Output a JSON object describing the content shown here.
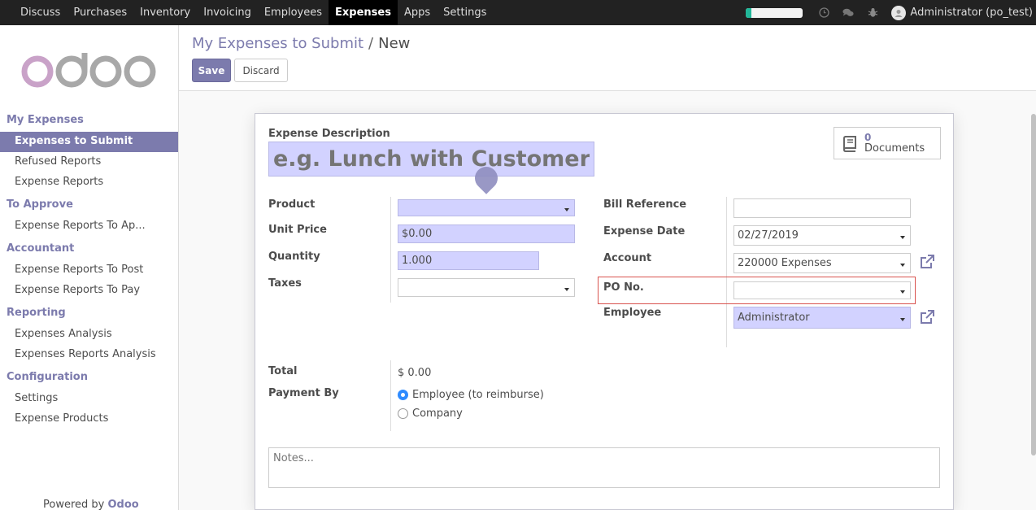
{
  "topbar": {
    "menu": [
      "Discuss",
      "Purchases",
      "Inventory",
      "Invoicing",
      "Employees",
      "Expenses",
      "Apps",
      "Settings"
    ],
    "active": "Expenses",
    "user": "Administrator (po_test)",
    "icons": [
      "clock-icon",
      "chat-icon",
      "bug-icon"
    ],
    "progress": 0.1
  },
  "sidebar": {
    "sections": [
      {
        "title": "My Expenses",
        "items": [
          "Expenses to Submit",
          "Refused Reports",
          "Expense Reports"
        ]
      },
      {
        "title": "To Approve",
        "items": [
          "Expense Reports To Ap..."
        ]
      },
      {
        "title": "Accountant",
        "items": [
          "Expense Reports To Post",
          "Expense Reports To Pay"
        ]
      },
      {
        "title": "Reporting",
        "items": [
          "Expenses Analysis",
          "Expenses Reports Analysis"
        ]
      },
      {
        "title": "Configuration",
        "items": [
          "Settings",
          "Expense Products"
        ]
      }
    ],
    "active_item": "Expenses to Submit",
    "powered_prefix": "Powered by",
    "powered_brand": "Odoo"
  },
  "control": {
    "breadcrumb_parent": "My Expenses to Submit",
    "breadcrumb_separator": "/",
    "breadcrumb_current": "New",
    "save_label": "Save",
    "discard_label": "Discard"
  },
  "form": {
    "description_label": "Expense Description",
    "description_placeholder": "e.g. Lunch with Customer",
    "documents_count": "0",
    "documents_label": "Documents",
    "product_label": "Product",
    "product_value": "",
    "unit_price_label": "Unit Price",
    "unit_price_value": "$0.00",
    "quantity_label": "Quantity",
    "quantity_value": "1.000",
    "taxes_label": "Taxes",
    "taxes_value": "",
    "bill_reference_label": "Bill Reference",
    "bill_reference_value": "",
    "expense_date_label": "Expense Date",
    "expense_date_value": "02/27/2019",
    "account_label": "Account",
    "account_value": "220000 Expenses",
    "po_label": "PO No.",
    "po_value": "",
    "employee_label": "Employee",
    "employee_value": "Administrator",
    "total_label": "Total",
    "total_value": "$ 0.00",
    "payment_label": "Payment By",
    "payment_options": [
      "Employee (to reimburse)",
      "Company"
    ],
    "payment_selected": "Employee (to reimburse)",
    "notes_placeholder": "Notes..."
  },
  "colors": {
    "brand": "#7c7bad",
    "required_field": "#d2d2ff",
    "highlight": "#d9534f",
    "radio_on": "#2e8bff"
  }
}
